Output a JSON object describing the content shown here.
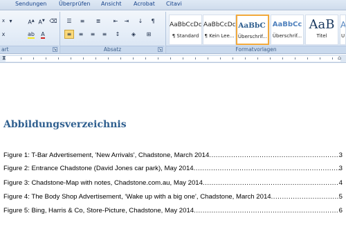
{
  "tabs": [
    "Sendungen",
    "Überprüfen",
    "Ansicht",
    "Acrobat",
    "Citavi"
  ],
  "ribbon": {
    "group_font_label": "art",
    "group_paragraph_label": "Absatz",
    "group_styles_label": "Formatvorlagen",
    "font_size_value": "x"
  },
  "styles": [
    {
      "sample": "AaBbCcDc",
      "name": "¶ Standard"
    },
    {
      "sample": "AaBbCcDc",
      "name": "¶ Kein Lee..."
    },
    {
      "sample": "AaBbC ",
      "name": "Überschrif..."
    },
    {
      "sample": "AaBbCc",
      "name": "Überschrif..."
    },
    {
      "sample": "AaB",
      "name": "Titel"
    },
    {
      "sample": "A",
      "name": "U"
    }
  ],
  "document": {
    "heading": "Abbildungsverzeichnis",
    "entries": [
      {
        "text": "Figure 1: T-Bar Advertisement, 'New Arrivals', Chadstone, March 2014",
        "page": "3"
      },
      {
        "text": "Figure 2: Entrance Chadstone (David Jones car park), May 2014",
        "page": "3"
      },
      {
        "text": "Figure 3: Chadstone-Map with notes, Chadstone.com.au, May 2014",
        "page": "4"
      },
      {
        "text": "Figure 4: The Body Shop Advertisement, ‘Wake up with a big one’, Chadstone, March 2014",
        "page": "5"
      },
      {
        "text": "Figure 5: Bing, Harris & Co, Store-Picture, Chadstone, May 2014",
        "page": "6"
      }
    ]
  },
  "colors": {
    "heading": "#2f5f8f",
    "selected_style_border": "#f2a93b",
    "active_button": "#fbd97a"
  }
}
